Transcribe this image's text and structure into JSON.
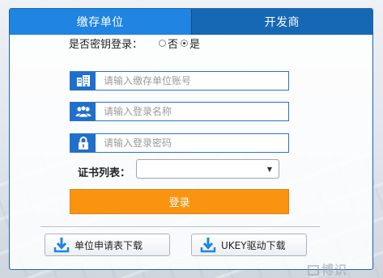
{
  "tabs": [
    {
      "label": "缴存单位",
      "active": true
    },
    {
      "label": "开发商",
      "active": false
    }
  ],
  "login_type": {
    "label": "是否密钥登录：",
    "options": [
      {
        "label": "否",
        "selected": false
      },
      {
        "label": "是",
        "selected": true
      }
    ]
  },
  "fields": {
    "account": {
      "icon": "building-icon",
      "placeholder": "请输入缴存单位账号",
      "value": ""
    },
    "username": {
      "icon": "users-icon",
      "placeholder": "请输入登录名称",
      "value": ""
    },
    "password": {
      "icon": "lock-icon",
      "placeholder": "请输入登录密码",
      "value": ""
    }
  },
  "cert": {
    "label": "证书列表：",
    "selected": ""
  },
  "login_button": "登录",
  "downloads": [
    {
      "label": "单位申请表下载",
      "icon": "download-icon"
    },
    {
      "label": "UKEY驱动下载",
      "icon": "download-icon"
    }
  ],
  "watermark": "博识",
  "colors": {
    "tab_active": "#1f84e2",
    "tab_inactive": "#1667b4",
    "login_button": "#fa9410",
    "icon_bg": "#1f6fcd",
    "download_arrow": "#1f84e2"
  }
}
